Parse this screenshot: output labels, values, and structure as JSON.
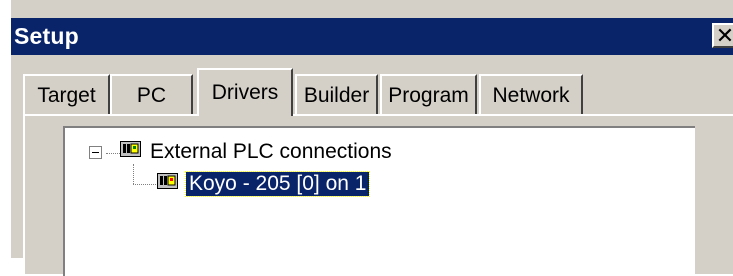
{
  "window": {
    "title": "Setup",
    "close_label": "✕"
  },
  "tabs": [
    {
      "label": "Target",
      "active": false
    },
    {
      "label": "PC",
      "active": false
    },
    {
      "label": "Drivers",
      "active": true
    },
    {
      "label": "Builder",
      "active": false
    },
    {
      "label": "Program",
      "active": false
    },
    {
      "label": "Network",
      "active": false
    }
  ],
  "tree": {
    "root": {
      "label": "External PLC connections",
      "expanded": true,
      "icon": "plc-icon"
    },
    "children": [
      {
        "label": "Koyo - 205 [0] on 1",
        "selected": true,
        "icon": "plc-icon"
      }
    ]
  },
  "colors": {
    "titlebar": "#0a246a",
    "face": "#d4d0c8",
    "selection": "#0a246a"
  }
}
